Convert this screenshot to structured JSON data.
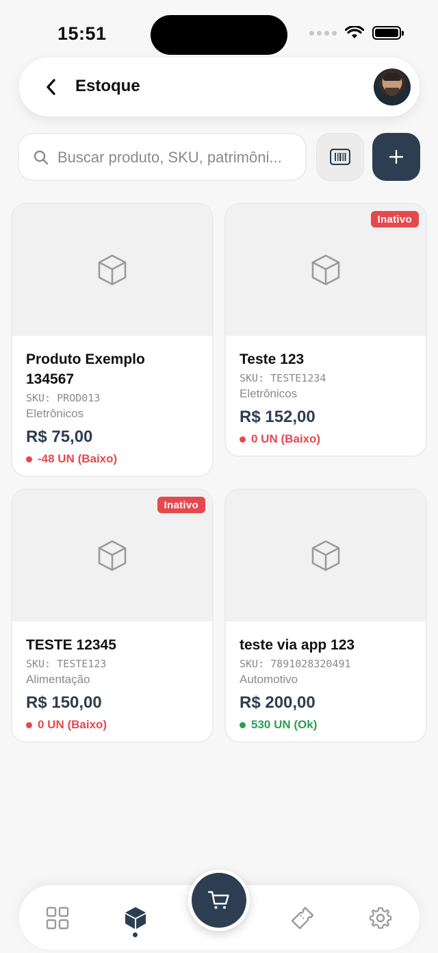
{
  "status_bar": {
    "time": "15:51"
  },
  "header": {
    "title": "Estoque"
  },
  "search": {
    "placeholder": "Buscar produto, SKU, patrimôni..."
  },
  "colors": {
    "primary": "#2d3e52",
    "danger": "#e5484d",
    "success": "#2c9e52",
    "muted": "#8a8a8a"
  },
  "products": [
    {
      "name": "Produto Exemplo 134567",
      "sku": "SKU: PROD013",
      "category": "Eletrônicos",
      "price": "R$ 75,00",
      "stock": "-48 UN (Baixo)",
      "stock_status": "low",
      "badge": ""
    },
    {
      "name": "Teste 123",
      "sku": "SKU: TESTE1234",
      "category": "Eletrônicos",
      "price": "R$ 152,00",
      "stock": "0 UN (Baixo)",
      "stock_status": "low",
      "badge": "Inativo"
    },
    {
      "name": "TESTE 12345",
      "sku": "SKU: TESTE123",
      "category": "Alimentação",
      "price": "R$ 150,00",
      "stock": "0 UN (Baixo)",
      "stock_status": "low",
      "badge": "Inativo"
    },
    {
      "name": "teste via app 123",
      "sku": "SKU: 7891028320491",
      "category": "Automotivo",
      "price": "R$ 200,00",
      "stock": "530 UN (Ok)",
      "stock_status": "ok",
      "badge": ""
    }
  ],
  "icons": {
    "back": "chevron-left-icon",
    "search": "search-icon",
    "barcode": "barcode-icon",
    "add": "plus-icon",
    "product_placeholder": "box-icon",
    "nav_dashboard": "grid-icon",
    "nav_stock": "box-filled-icon",
    "nav_cart": "cart-icon",
    "nav_tickets": "ticket-icon",
    "nav_settings": "gear-icon"
  },
  "bottom_nav": {
    "active": "stock"
  }
}
